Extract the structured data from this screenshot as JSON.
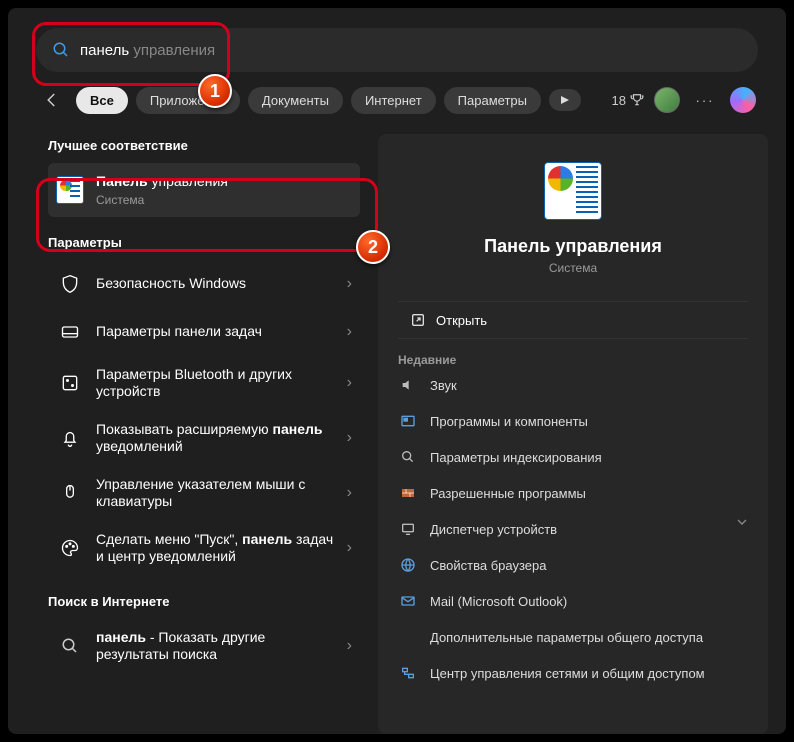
{
  "search": {
    "typed": "панель",
    "ghost": " управления"
  },
  "filters": {
    "items": [
      {
        "label": "Все",
        "active": true
      },
      {
        "label": "Приложения"
      },
      {
        "label": "Документы"
      },
      {
        "label": "Интернет"
      },
      {
        "label": "Параметры"
      }
    ]
  },
  "header": {
    "points": "18"
  },
  "sections": {
    "best": "Лучшее соответствие",
    "params": "Параметры",
    "web": "Поиск в Интернете"
  },
  "best_result": {
    "title_bold": "Панель",
    "title_rest": " управления",
    "sub": "Система"
  },
  "params_results": [
    {
      "icon": "shield",
      "title": "Безопасность Windows"
    },
    {
      "icon": "taskbar",
      "title": "Параметры панели задач"
    },
    {
      "icon": "bluetooth",
      "title": "Параметры Bluetooth и других устройств"
    },
    {
      "icon": "bell",
      "title_pre": "Показывать расширяемую ",
      "title_bold": "панель",
      "title_post": " уведомлений"
    },
    {
      "icon": "mouse",
      "title": "Управление указателем мыши с клавиатуры"
    },
    {
      "icon": "palette",
      "title_pre": "Сделать меню \"Пуск\", ",
      "title_bold": "панель",
      "title_post": " задач и центр уведомлений"
    }
  ],
  "web_results": [
    {
      "title_bold": "панель",
      "title_post": " - Показать другие результаты поиска"
    }
  ],
  "preview": {
    "title": "Панель управления",
    "sub": "Система",
    "open_label": "Открыть",
    "recent_header": "Недавние",
    "recent": [
      {
        "icon": "sound",
        "name": "Звук"
      },
      {
        "icon": "programs",
        "name": "Программы и компоненты"
      },
      {
        "icon": "indexing",
        "name": "Параметры индексирования"
      },
      {
        "icon": "firewall",
        "name": "Разрешенные программы"
      },
      {
        "icon": "devmgr",
        "name": "Диспетчер устройств"
      },
      {
        "icon": "browser",
        "name": "Свойства браузера"
      },
      {
        "icon": "mail",
        "name": "Mail (Microsoft Outlook)"
      },
      {
        "icon": "sharing",
        "name": "Дополнительные параметры общего доступа"
      },
      {
        "icon": "network",
        "name": "Центр управления сетями и общим доступом"
      }
    ]
  },
  "annotations": {
    "one": "1",
    "two": "2"
  }
}
